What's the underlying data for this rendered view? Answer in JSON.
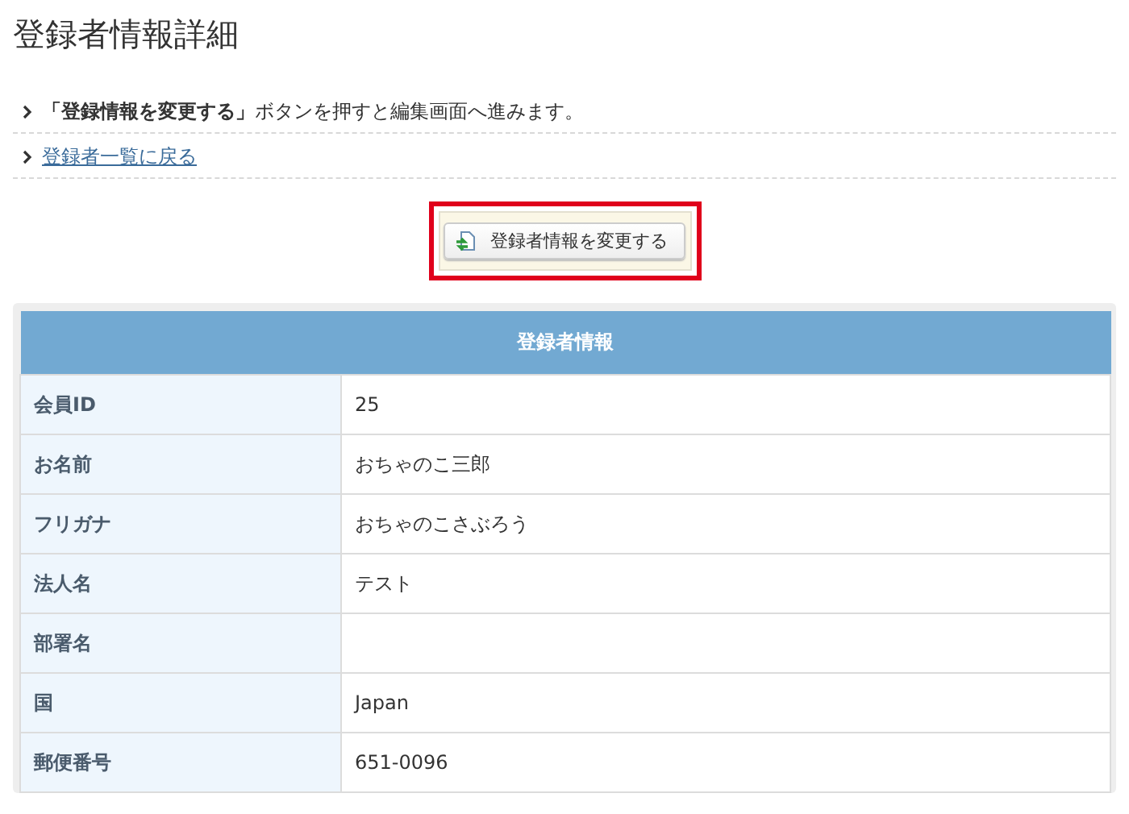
{
  "title": "登録者情報詳細",
  "notes": [
    {
      "kind": "text",
      "text": "**「登録情報を変更する」**ボタンを押すと編集画面へ進みます。"
    },
    {
      "kind": "link",
      "text": "登録者一覧に戻る"
    }
  ],
  "edit_button": {
    "label": "登録者情報を変更する"
  },
  "table": {
    "title": "登録者情報",
    "rows": [
      {
        "label": "会員ID",
        "value": "25"
      },
      {
        "label": "お名前",
        "value": "おちゃのこ三郎"
      },
      {
        "label": "フリガナ",
        "value": "おちゃのこさぶろう"
      },
      {
        "label": "法人名",
        "value": "テスト"
      },
      {
        "label": "部署名"
      },
      {
        "label": "国",
        "value": "Japan"
      },
      {
        "label": "郵便番号",
        "value": "651-0096"
      }
    ]
  }
}
